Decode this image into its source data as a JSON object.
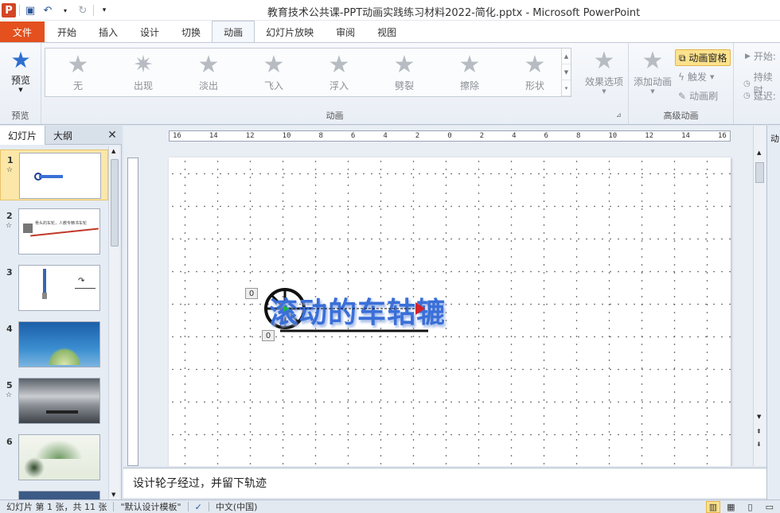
{
  "window": {
    "title": "教育技术公共课-PPT动画实践练习材料2022-简化.pptx  -  Microsoft PowerPoint"
  },
  "ribbon_tabs": [
    "文件",
    "开始",
    "插入",
    "设计",
    "切换",
    "动画",
    "幻灯片放映",
    "审阅",
    "视图"
  ],
  "ribbon": {
    "preview": {
      "label": "预览",
      "group": "预览"
    },
    "animations": {
      "items": [
        "无",
        "出现",
        "淡出",
        "飞入",
        "浮入",
        "劈裂",
        "擦除",
        "形状"
      ],
      "effect_options": "效果选项",
      "group": "动画"
    },
    "advanced": {
      "add_animation": "添加动画",
      "animation_pane": "动画窗格",
      "trigger": "触发",
      "painter": "动画刷",
      "group": "高级动画"
    },
    "timing": {
      "start": "开始:",
      "duration": "持续时",
      "delay": "延迟:"
    }
  },
  "left_pane": {
    "tabs": [
      "幻灯片",
      "大纲"
    ],
    "slides": [
      {
        "num": "1",
        "star": "☆"
      },
      {
        "num": "2",
        "star": "☆"
      },
      {
        "num": "3",
        "star": ""
      },
      {
        "num": "4",
        "star": ""
      },
      {
        "num": "5",
        "star": "☆"
      },
      {
        "num": "6",
        "star": ""
      }
    ],
    "slide2_text": "骨头的车轮，人教专精书车轮"
  },
  "ruler": {
    "labels": [
      "16",
      "14",
      "12",
      "10",
      "8",
      "6",
      "4",
      "2",
      "0",
      "2",
      "4",
      "6",
      "8",
      "10",
      "12",
      "14",
      "16"
    ]
  },
  "slide": {
    "title": "滚动的车轱辘",
    "tag_top": "0",
    "tag_bottom": "0"
  },
  "notes": {
    "text": "设计轮子经过，并留下轨迹"
  },
  "status": {
    "slide_info": "幻灯片 第 1 张，共 11 张",
    "theme": "\"默认设计模板\"",
    "language": "中文(中国)"
  }
}
